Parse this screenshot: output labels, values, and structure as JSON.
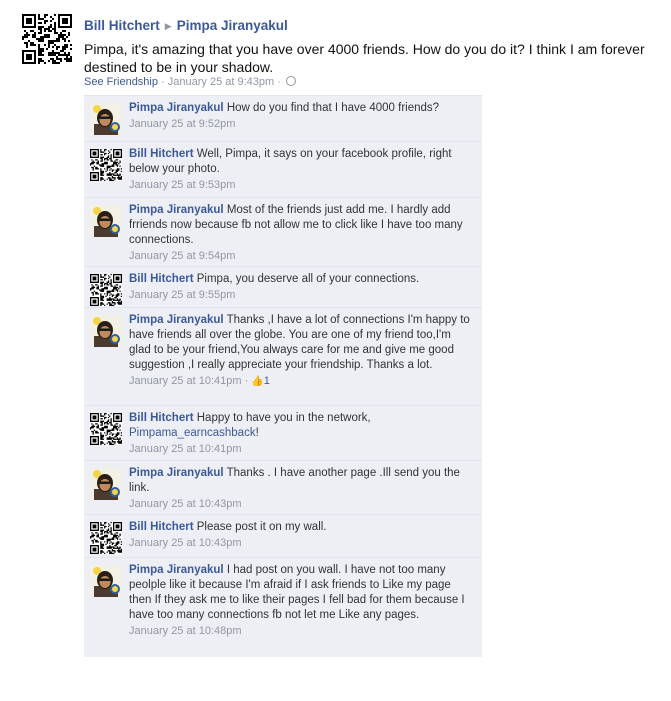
{
  "post": {
    "author": "Bill Hitchert",
    "recipient": "Pimpa Jiranyakul",
    "text": "Pimpa, it's amazing that you have over 4000 friends. How do you do it? I think I am forever destined to be in your shadow.",
    "see_friendship": "See Friendship",
    "sep": " · ",
    "time": "January 25 at 9:43pm",
    "sep2": " · "
  },
  "comments": [
    {
      "author": "Pimpa Jiranyakul",
      "avatar": "person-photo",
      "text": "How do you find that I have 4000 friends?",
      "time": "January 25 at 9:52pm"
    },
    {
      "author": "Bill Hitchert",
      "avatar": "qr-code",
      "text": "Well, Pimpa, it says on your facebook profile, right below your photo.",
      "time": "January 25 at 9:53pm"
    },
    {
      "author": "Pimpa Jiranyakul",
      "avatar": "person-photo",
      "text": "Most of the friends just add me. I hardly add frriends now because fb not allow me to click like I have too many connections.",
      "time": "January 25 at 9:54pm"
    },
    {
      "author": "Bill Hitchert",
      "avatar": "qr-code",
      "text": "Pimpa, you deserve all of your connections.",
      "time": "January 25 at 9:55pm"
    },
    {
      "author": "Pimpa Jiranyakul",
      "avatar": "person-photo",
      "text": "Thanks ,I have a lot of connections I'm happy to have friends all over the globe. You are one of my friend too,I'm glad to be your friend,You always care for me and give me good suggestion ,I really appreciate your friendship. Thanks a lot.",
      "time": "January 25 at 10:41pm",
      "like_sep": " · ",
      "likes": "1"
    },
    {
      "author": "Bill Hitchert",
      "avatar": "qr-code",
      "text": "Happy to have you in the network,",
      "link": "Pimpama_earncashback",
      "text_after": "!",
      "time": "January 25 at 10:41pm"
    },
    {
      "author": "Pimpa Jiranyakul",
      "avatar": "person-photo",
      "text": "Thanks . I have another page .Ill send you the link.",
      "time": "January 25 at 10:43pm"
    },
    {
      "author": "Bill Hitchert",
      "avatar": "qr-code",
      "text": "Please post it on my wall.",
      "time": "January 25 at 10:43pm"
    },
    {
      "author": "Pimpa Jiranyakul",
      "avatar": "person-photo",
      "text": "I had post on you wall. I have not too many peolple like it because I'm afraid if I ask friends to Like my page then If they ask me to like their pages I fell bad for them because I have too many connections fb not let me Like any pages.",
      "time": "January 25 at 10:48pm"
    }
  ],
  "colors": {
    "link": "#3b5998",
    "meta": "#9197a3",
    "comment_bg": "#edeff4"
  }
}
